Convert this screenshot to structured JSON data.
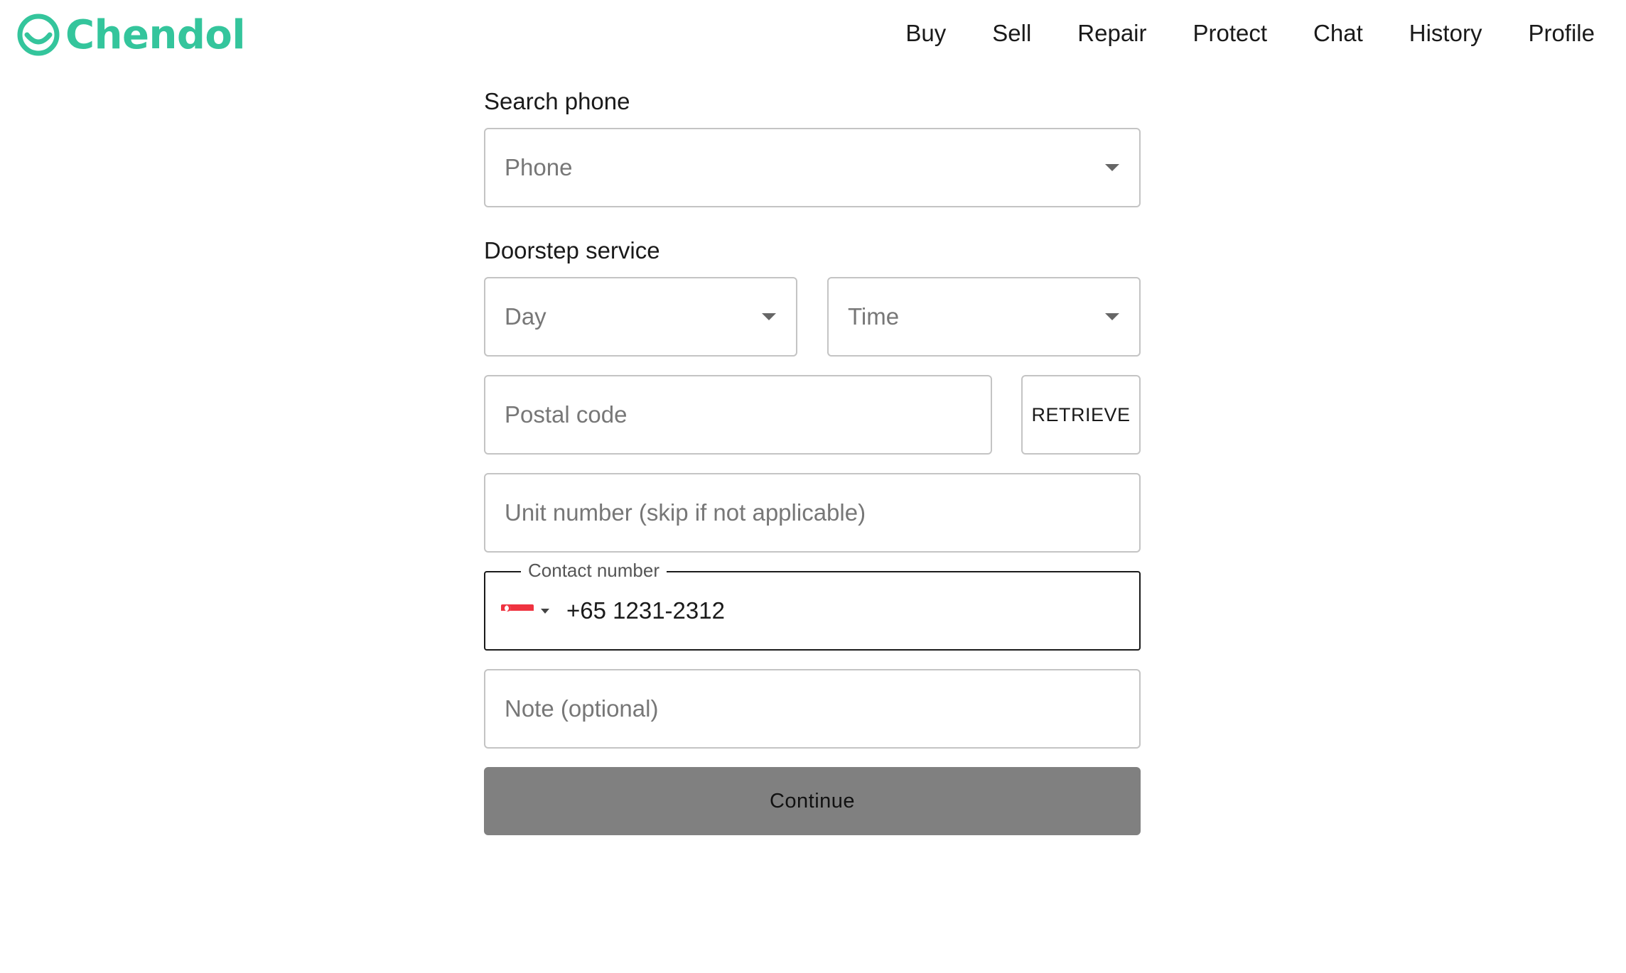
{
  "brand": {
    "name": "Chendol",
    "color": "#34c59c"
  },
  "nav": {
    "items": [
      {
        "label": "Buy"
      },
      {
        "label": "Sell"
      },
      {
        "label": "Repair"
      },
      {
        "label": "Protect"
      },
      {
        "label": "Chat"
      },
      {
        "label": "History"
      },
      {
        "label": "Profile"
      }
    ]
  },
  "form": {
    "search_label": "Search phone",
    "phone_placeholder": "Phone",
    "doorstep_label": "Doorstep service",
    "day_placeholder": "Day",
    "time_placeholder": "Time",
    "postal_placeholder": "Postal code",
    "retrieve_label": "RETRIEVE",
    "unit_placeholder": "Unit number (skip if not applicable)",
    "contact_label": "Contact number",
    "contact_value": "+65 1231-2312",
    "contact_country_icon": "singapore-flag-icon",
    "note_placeholder": "Note (optional)",
    "continue_label": "Continue"
  }
}
